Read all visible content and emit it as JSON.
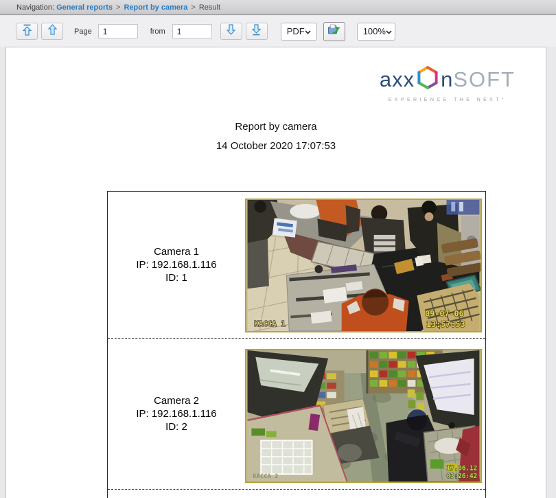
{
  "navigation": {
    "prefix": "Navigation: ",
    "link1": "General reports",
    "sep1": ">",
    "link2": "Report by camera",
    "sep2": ">",
    "current": "Result"
  },
  "toolbar": {
    "page_label": "Page",
    "page_value": "1",
    "from_label": "from",
    "pages_total_value": "1",
    "format_selected": "PDF",
    "zoom_selected": "100%",
    "icons": {
      "first_page": "⤒",
      "previous_page": "↑",
      "next_page": "↓",
      "last_page": "⤓",
      "export": "open-report-folder-with-green-arrow",
      "dropdown": "⌄"
    }
  },
  "report": {
    "logo": {
      "part1": "axx",
      "part2": "n",
      "part3": "SOFT",
      "tagline": "EXPERIENCE THE NEXT°"
    },
    "title": "Report by camera",
    "generated": "14 October 2020 17:07:53"
  },
  "cameras": [
    {
      "name": "Camera 1",
      "ip": "IP: 192.168.1.116",
      "id": "ID: 1",
      "osd_label": "KACCA 1",
      "osd_date": "09-07-06",
      "osd_time": "13:57:53"
    },
    {
      "name": "Camera 2",
      "ip": "IP: 192.168.1.116",
      "id": "ID: 2",
      "osd_label": "KACCA 2",
      "osd_date": "17.06.12",
      "osd_time": "03:26:42"
    }
  ],
  "colors": {
    "link_blue": "#2b7ac0",
    "arrow_blue": "#3e8ecb",
    "snapshot_border": "#b5a437",
    "osd_yellow": "#e8d44e"
  }
}
